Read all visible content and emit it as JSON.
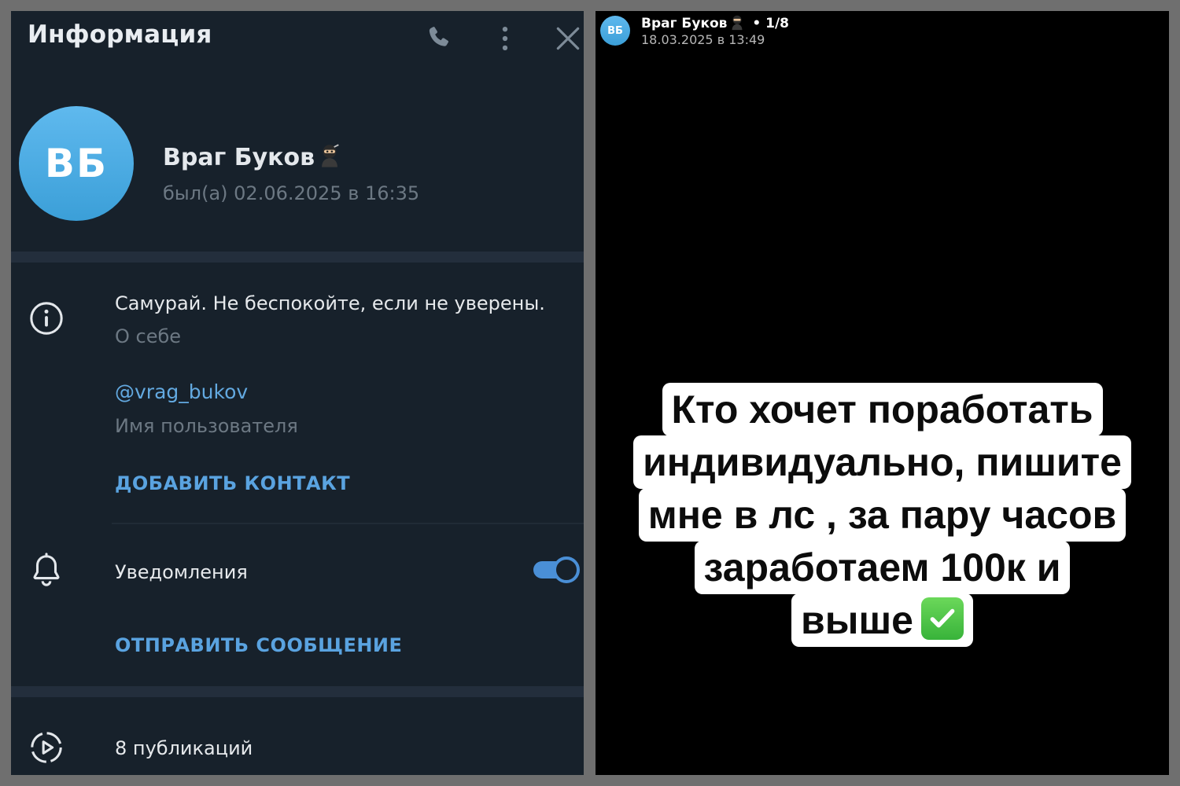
{
  "info_panel": {
    "header": {
      "title": "Информация",
      "icons": [
        "phone-icon",
        "more-vertical-icon",
        "close-icon"
      ]
    },
    "profile": {
      "avatar_initials": "ВБ",
      "name": "Враг Буков",
      "status": "был(а) 02.06.2025 в 16:35"
    },
    "about": {
      "text": "Самурай. Не беспокойте, если не уверены.",
      "label": "О себе"
    },
    "username": {
      "value": "@vrag_bukov",
      "label": "Имя пользователя"
    },
    "add_contact_label": "ДОБАВИТЬ КОНТАКТ",
    "notifications": {
      "label": "Уведомления",
      "enabled": true
    },
    "send_message_label": "ОТПРАВИТЬ СООБЩЕНИЕ",
    "publications_label": "8 публикаций"
  },
  "story_viewer": {
    "avatar_initials": "ВБ",
    "author": "Враг Буков",
    "counter": "• 1/8",
    "date": "18.03.2025 в 13:49",
    "current_story": 1,
    "total_stories": 8,
    "caption_lines": [
      "Кто хочет поработать",
      "индивидуально, пишите",
      "мне в лс , за пару часов",
      "заработаем 100к и",
      "выше"
    ]
  },
  "colors": {
    "panel_bg": "#17212b",
    "accent": "#5aa3e0",
    "avatar": "#4fb0e6"
  }
}
